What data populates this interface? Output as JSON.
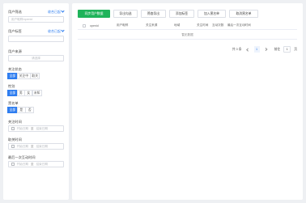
{
  "sidebar": {
    "user_filter_label": "用户筛选",
    "collapse_link": "收合已起",
    "user_filter_placeholder": "用户昵称/openid",
    "user_tag_label": "用户标签",
    "user_tag_link": "收合已起",
    "user_tag_placeholder": "",
    "user_source_label": "用户来源",
    "user_source_placeholder": "请选择",
    "follow_status": {
      "label": "关注状态",
      "options": [
        "全部",
        "关注中",
        "取关"
      ],
      "selected": 0
    },
    "gender": {
      "label": "性别",
      "options": [
        "全部",
        "男",
        "女",
        "未知"
      ],
      "selected": 0
    },
    "blacklist": {
      "label": "黑名单",
      "options": [
        "全部",
        "是",
        "否"
      ],
      "selected": 0
    },
    "follow_time": {
      "label": "关注时间",
      "start": "开始日期",
      "sep": "至",
      "end": "结束日期"
    },
    "unfollow_time": {
      "label": "取关时间",
      "start": "开始日期",
      "sep": "至",
      "end": "结束日期"
    },
    "last_interact": {
      "label": "最后一次互动时间",
      "start": "开始日期",
      "sep": "至",
      "end": "结束日期"
    }
  },
  "toolbar": {
    "sync": "同步用户数据",
    "export_selected": "导出勾选",
    "export_filtered": "筛查导出",
    "add_tag": "添加标签",
    "add_blacklist": "加入黑名单",
    "remove_blacklist": "取消黑名单"
  },
  "table": {
    "columns": [
      "openid",
      "用户昵称",
      "关注来源",
      "地域",
      "关注时间",
      "互动次数",
      "最后一次互动时间"
    ],
    "empty_text": "暂无数据"
  },
  "pager": {
    "total": "共 0 条",
    "current_page": "1",
    "goto_label": "前往",
    "goto_value": "1",
    "page_suffix": "页"
  },
  "colors": {
    "primary_blue": "#2e7df0",
    "sync_green": "#1fb35a"
  }
}
